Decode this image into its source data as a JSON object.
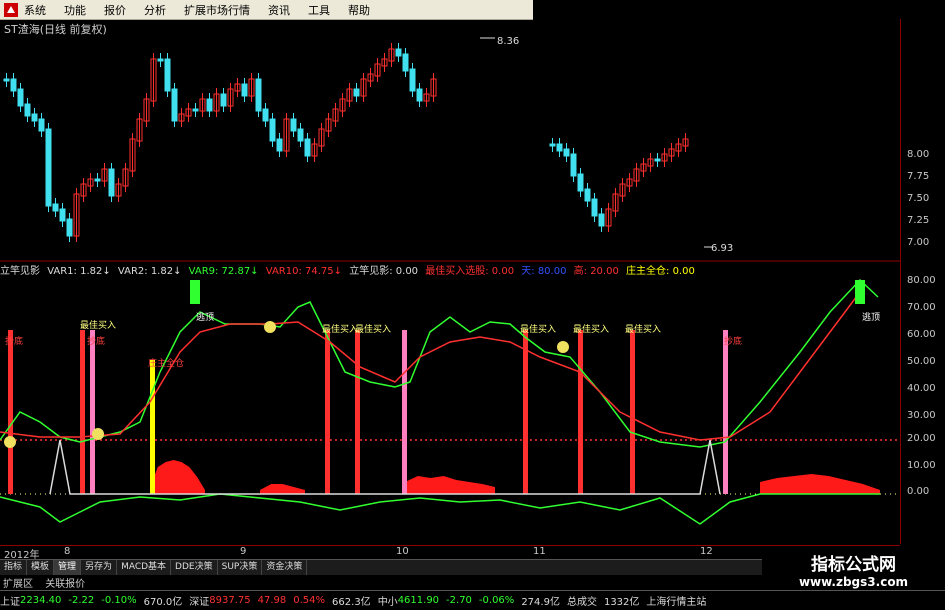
{
  "menu": [
    {
      "name": "menu-system",
      "label": "系统"
    },
    {
      "name": "menu-function",
      "label": "功能"
    },
    {
      "name": "menu-quote",
      "label": "报价"
    },
    {
      "name": "menu-analysis",
      "label": "分析"
    },
    {
      "name": "menu-ext-market",
      "label": "扩展市场行情"
    },
    {
      "name": "menu-info",
      "label": "资讯"
    },
    {
      "name": "menu-tools",
      "label": "工具"
    },
    {
      "name": "menu-help",
      "label": "帮助"
    }
  ],
  "stock_title": "ST渣海(日线 前复权)",
  "main_chart": {
    "high_label": "8.36",
    "low_label": "6.93",
    "price_axis": [
      "8.00",
      "7.75",
      "7.50",
      "7.25",
      "7.00"
    ]
  },
  "indicator_line": [
    {
      "text": "立竿见影",
      "color": "#dcdcdc"
    },
    {
      "text": "VAR1: 1.82↓",
      "color": "#dcdcdc"
    },
    {
      "text": "VAR2: 1.82↓",
      "color": "#dcdcdc"
    },
    {
      "text": "VAR9: 72.87↓",
      "color": "#30ff30"
    },
    {
      "text": "VAR10: 74.75↓",
      "color": "#ff3030"
    },
    {
      "text": "立竿见影: 0.00",
      "color": "#dcdcdc"
    },
    {
      "text": "最佳买入选股: 0.00",
      "color": "#ff3030"
    },
    {
      "text": "天: 80.00",
      "color": "#3050ff"
    },
    {
      "text": "高: 20.00",
      "color": "#ff3030"
    },
    {
      "text": "庄主全仓: 0.00",
      "color": "#ffff00"
    }
  ],
  "sub_chart": {
    "axis": [
      "80.00",
      "70.00",
      "60.00",
      "50.00",
      "40.00",
      "30.00",
      "20.00",
      "10.00",
      "0.00"
    ],
    "labels": [
      {
        "t": "逃顶",
        "c": "#ffffff"
      },
      {
        "t": "最佳买入",
        "c": "#ffff80"
      },
      {
        "t": "抄底",
        "c": "#ff4040"
      },
      {
        "t": "抄底",
        "c": "#ff4040"
      },
      {
        "t": "庄主全仓",
        "c": "#ff4040"
      },
      {
        "t": "最佳买入",
        "c": "#ffff80"
      },
      {
        "t": "最佳买入",
        "c": "#ffff80"
      },
      {
        "t": "最佳买入",
        "c": "#ffff80"
      },
      {
        "t": "最佳买入",
        "c": "#ffff80"
      },
      {
        "t": "最佳买入",
        "c": "#ffff80"
      },
      {
        "t": "抄底",
        "c": "#ff4040"
      },
      {
        "t": "逃顶",
        "c": "#ffffff"
      }
    ]
  },
  "dates": [
    "2012年",
    "8",
    "9",
    "10",
    "11",
    "12"
  ],
  "tabs": [
    "指标",
    "模板",
    "管理",
    "另存为",
    "MACD基本",
    "DDE决策",
    "SUP决策",
    "资金决策"
  ],
  "subtabs": [
    "扩展区",
    "关联报价"
  ],
  "status": [
    {
      "label": "上证",
      "value": "2234.40",
      "chg": "-2.22",
      "pct": "-0.10%",
      "amt": "670.0亿"
    },
    {
      "label": "深证",
      "value": "8937.75",
      "chg": "47.98",
      "pct": "0.54%",
      "amt": "662.3亿"
    },
    {
      "label": "中小",
      "value": "4611.90",
      "chg": "-2.70",
      "pct": "-0.06%",
      "amt": "274.9亿"
    }
  ],
  "status_extra": [
    "总成交",
    "1332亿",
    "上海行情主站"
  ],
  "watermark": {
    "line1": "指标公式网",
    "line2": "www.zbgs3.com"
  }
}
